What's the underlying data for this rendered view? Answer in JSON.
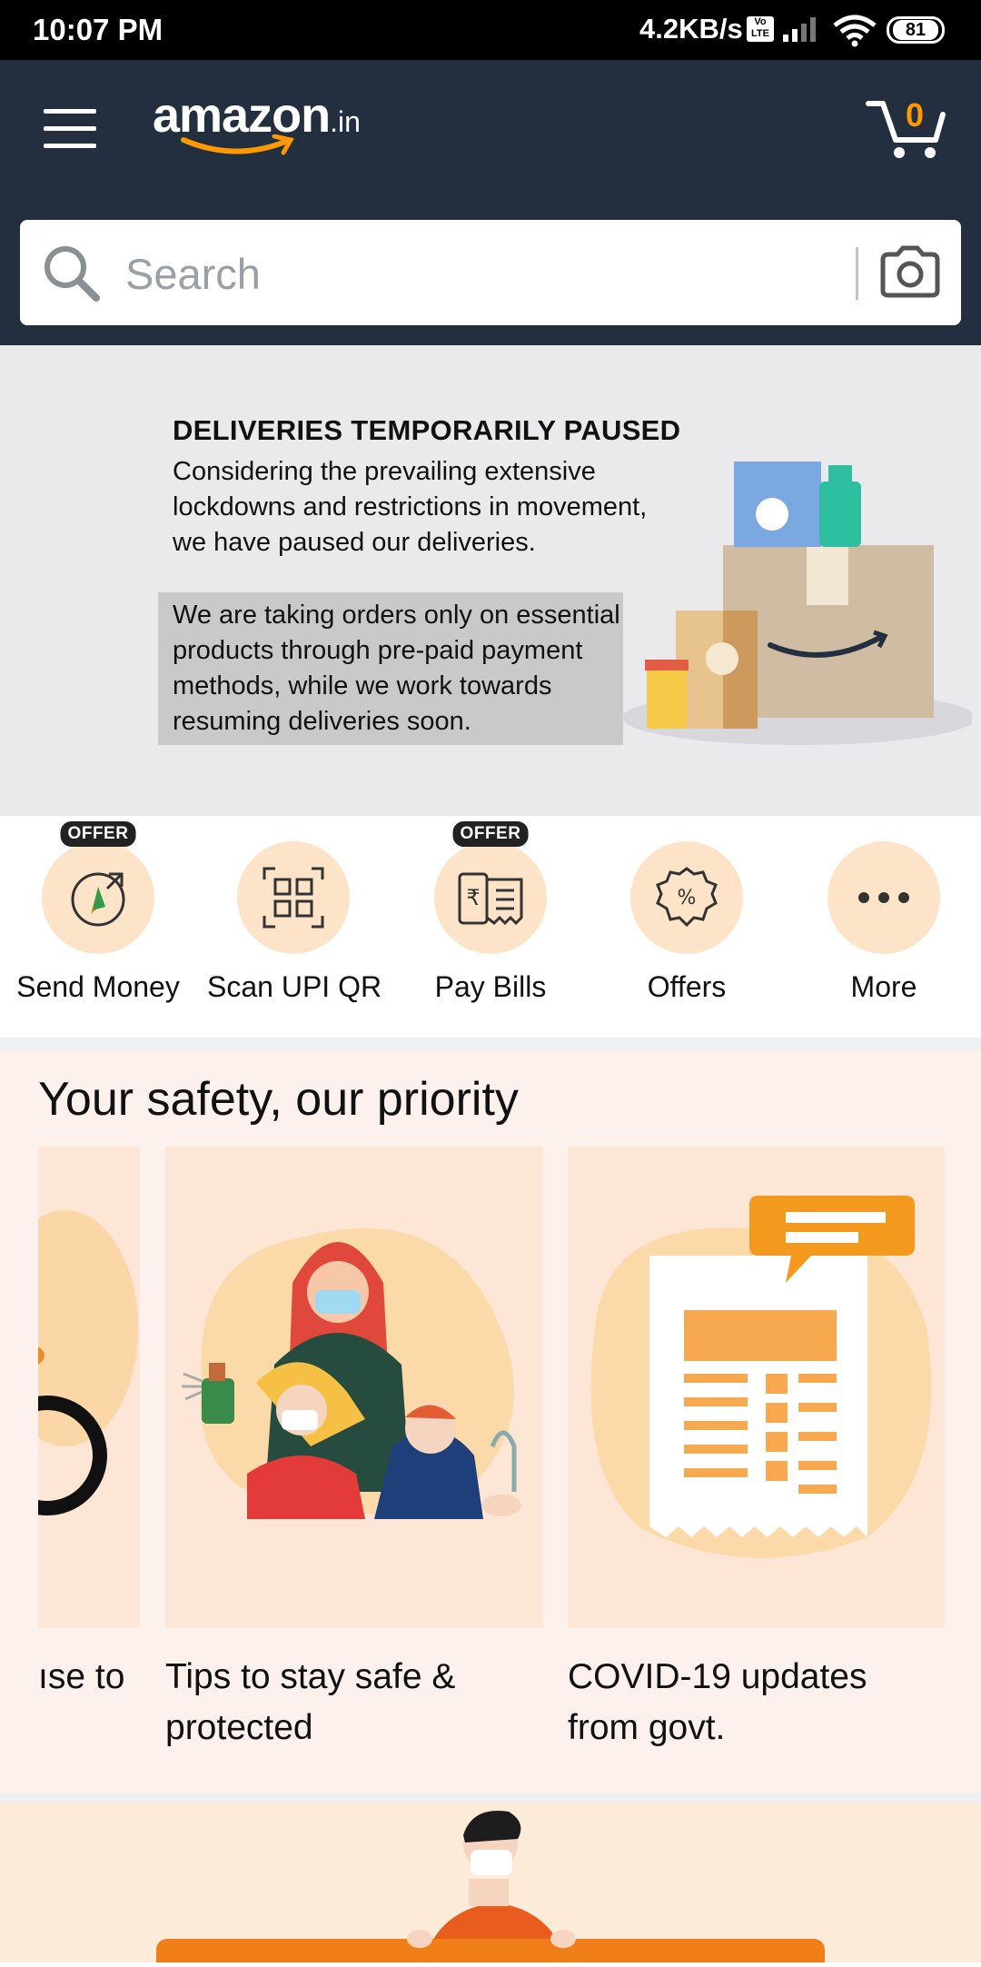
{
  "status_bar": {
    "time": "10:07 PM",
    "speed": "4.2KB/s",
    "volte": "Vo LTE",
    "battery": "81"
  },
  "header": {
    "logo_main": "amazon",
    "logo_tld": ".in",
    "cart_count": "0",
    "search_placeholder": "Search"
  },
  "banner": {
    "title": "DELIVERIES TEMPORARILY PAUSED",
    "paragraph": "Considering the prevailing extensive lockdowns and restrictions in movement, we have paused our deliveries.",
    "highlight": "We are taking orders only on essential products through pre-paid payment methods, while we work towards resuming deliveries soon."
  },
  "quick_actions": [
    {
      "label": "Send Money",
      "badge": "OFFER",
      "icon": "send-money-icon"
    },
    {
      "label": "Scan UPI QR",
      "badge": "",
      "icon": "qr-code-icon"
    },
    {
      "label": "Pay Bills",
      "badge": "OFFER",
      "icon": "bill-icon"
    },
    {
      "label": "Offers",
      "badge": "",
      "icon": "percent-badge-icon"
    },
    {
      "label": "More",
      "badge": "",
      "icon": "more-dots-icon"
    }
  ],
  "safety": {
    "title": "Your safety, our priority",
    "cards": [
      {
        "text": "ıse to"
      },
      {
        "text": "Tips to stay safe & protected"
      },
      {
        "text": "COVID-19 updates from govt."
      }
    ]
  },
  "colors": {
    "header_bg": "#232f3e",
    "accent": "#ff9900",
    "action_circle": "#fde4c8",
    "safety_bg": "#fdf1ee"
  }
}
